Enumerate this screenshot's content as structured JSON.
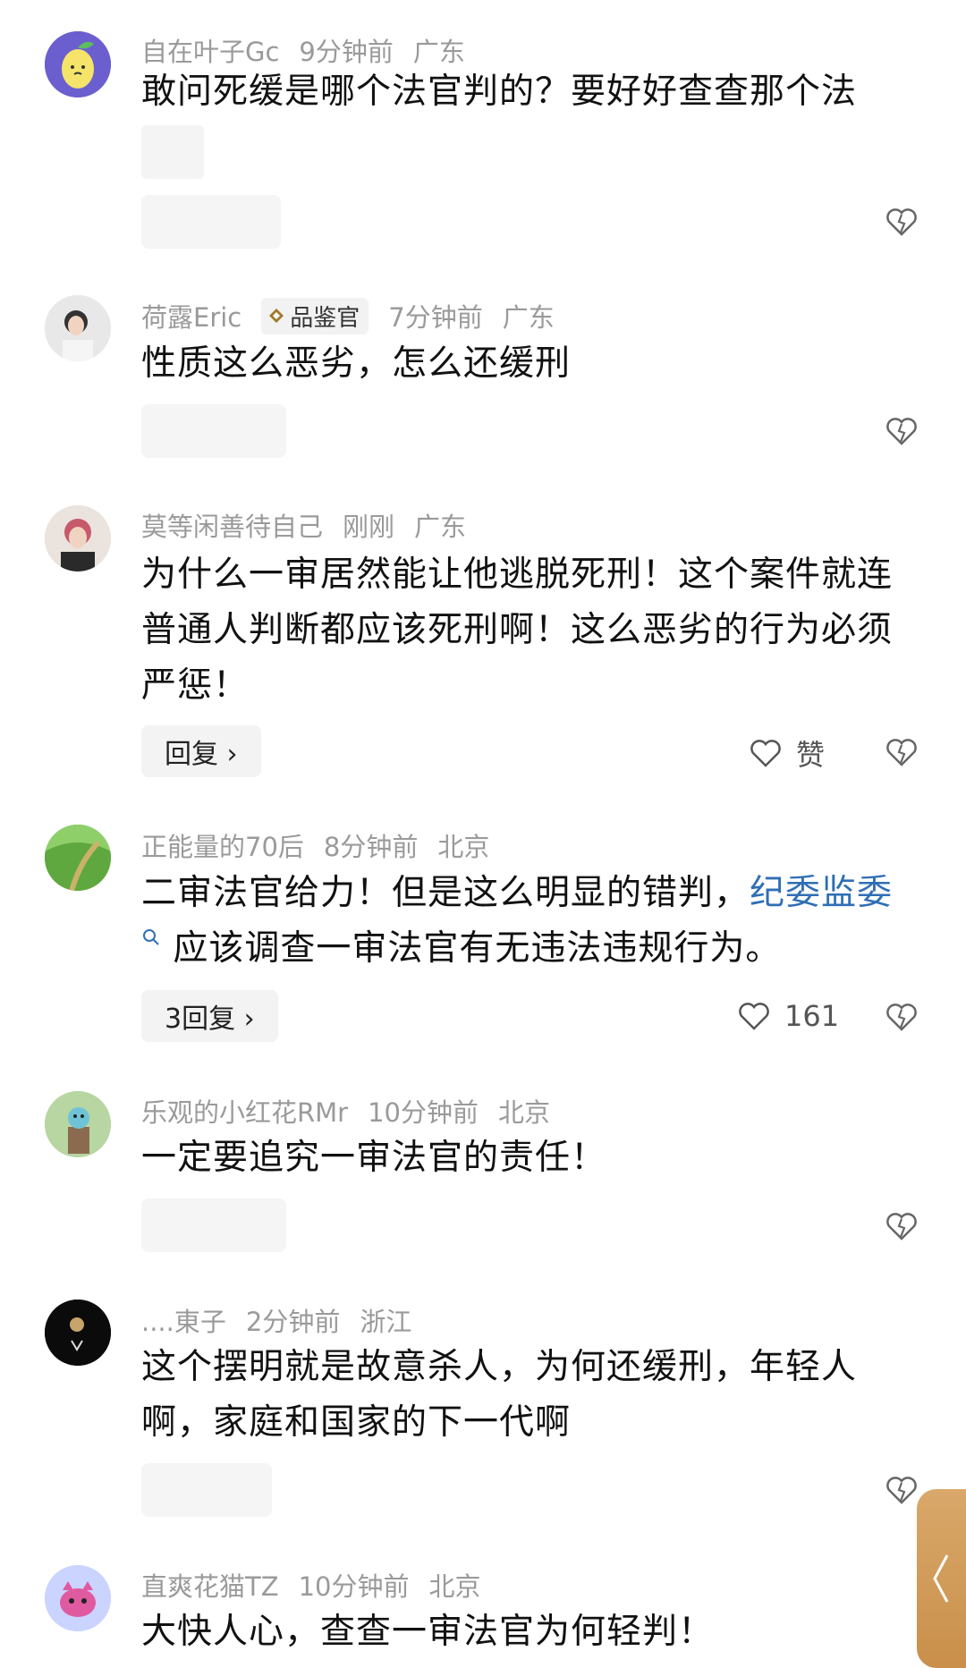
{
  "comments": [
    {
      "user": "自在叶子Gc",
      "time": "9分钟前",
      "location": "广东",
      "text": "敢问死缓是哪个法官判的？要好好查查那个法",
      "avatar_color": "#6a5acd"
    },
    {
      "user": "荷露Eric",
      "badge": "品鉴官",
      "time": "7分钟前",
      "location": "广东",
      "text": "性质这么恶劣，怎么还缓刑"
    },
    {
      "user": "莫等闲善待自己",
      "time": "刚刚",
      "location": "广东",
      "text": "为什么一审居然能让他逃脱死刑！这个案件就连普通人判断都应该死刑啊！这么恶劣的行为必须严惩！",
      "reply_label": "回复 ›",
      "like_label": "赞"
    },
    {
      "user": "正能量的70后",
      "time": "8分钟前",
      "location": "北京",
      "text_before": "二审法官给力！但是这么明显的错判，",
      "keyword": "纪委监委",
      "text_after": " 应该调查一审法官有无违法违规行为。",
      "reply_label": "3回复 ›",
      "like_count": "161"
    },
    {
      "user": "乐观的小红花RMr",
      "time": "10分钟前",
      "location": "北京",
      "text": "一定要追究一审法官的责任！"
    },
    {
      "user": "....東子",
      "time": "2分钟前",
      "location": "浙江",
      "text": "这个摆明就是故意杀人，为何还缓刑，年轻人啊，家庭和国家的下一代啊"
    },
    {
      "user": "直爽花猫TZ",
      "time": "10分钟前",
      "location": "北京",
      "text": "大快人心，查查一审法官为何轻判！"
    }
  ],
  "colors": {
    "keyword": "#2f6fb5",
    "meta": "#9a9a9a",
    "text": "#111111"
  }
}
